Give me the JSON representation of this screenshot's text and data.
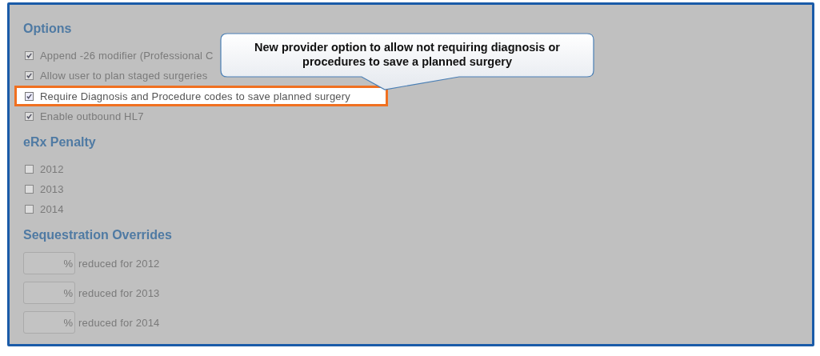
{
  "callout": {
    "text": "New provider option to allow not requiring diagnosis or procedures to save a planned surgery"
  },
  "sections": [
    {
      "kind": "checkboxes",
      "title": "Options",
      "items": [
        {
          "label": "Append -26 modifier (Professional C",
          "checked": true,
          "highlighted": false
        },
        {
          "label": "Allow user to plan staged surgeries",
          "checked": true,
          "highlighted": false
        },
        {
          "label": "Require Diagnosis and Procedure codes to save planned surgery",
          "checked": true,
          "highlighted": true
        },
        {
          "label": "Enable outbound HL7",
          "checked": true,
          "highlighted": false
        }
      ]
    },
    {
      "kind": "checkboxes",
      "title": "eRx Penalty",
      "items": [
        {
          "label": "2012",
          "checked": false,
          "highlighted": false
        },
        {
          "label": "2013",
          "checked": false,
          "highlighted": false
        },
        {
          "label": "2014",
          "checked": false,
          "highlighted": false
        }
      ]
    },
    {
      "kind": "fields",
      "title": "Sequestration Overrides",
      "items": [
        {
          "unit": "%",
          "label": "reduced for 2012"
        },
        {
          "unit": "%",
          "label": "reduced for 2013"
        },
        {
          "unit": "%",
          "label": "reduced for 2014"
        }
      ]
    }
  ]
}
